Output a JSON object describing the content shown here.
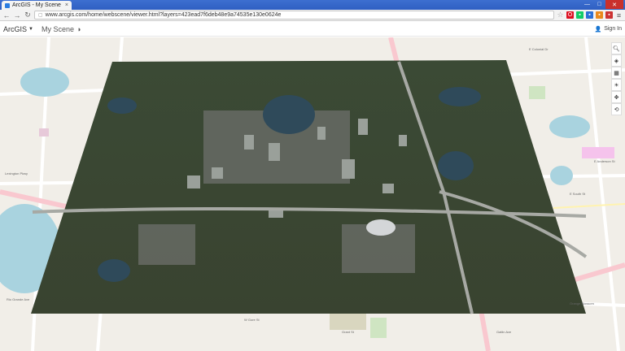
{
  "browser": {
    "tab_title": "ArcGIS - My Scene",
    "tab_close": "×",
    "url": "www.arcgis.com/home/webscene/viewer.html?layers=423ead7f6deb48e9a74535e130e0624e",
    "window_controls": {
      "minimize": "—",
      "maximize": "□",
      "close": "✕"
    }
  },
  "app": {
    "brand": "ArcGIS",
    "scene_title": "My Scene",
    "sign_in": "Sign In"
  },
  "scene_tools": [
    "search-icon",
    "layers-icon",
    "basemap-icon",
    "daylight-icon",
    "pan-icon",
    "rotate-icon"
  ],
  "map_labels": {
    "top_right_avenue": "E Colonial Dr",
    "mid_right_avenue": "E South St",
    "bottom_left_road": "Orange Blossom",
    "right_edge": "E Anderson St",
    "left_mid": "Lexington Pkwy",
    "bottom_mid": "W Gore St",
    "bottom_center": "Grant St",
    "bottom_right": "Gatlin Ave",
    "left_bottom": "Rio Grande Ave"
  }
}
